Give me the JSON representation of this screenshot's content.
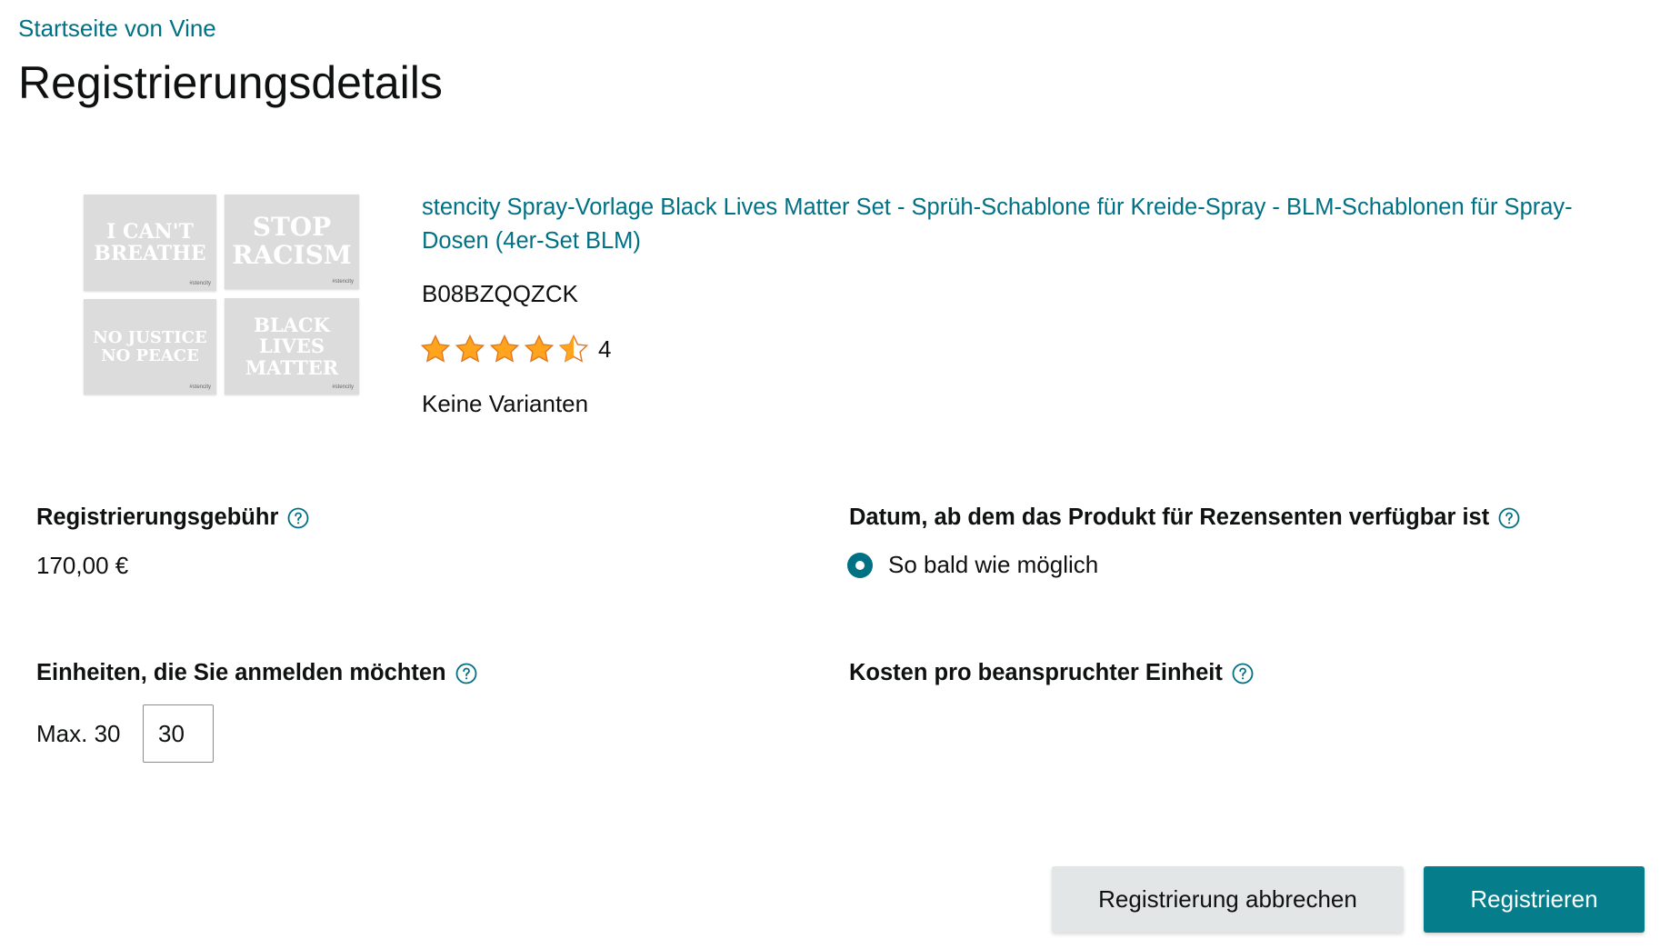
{
  "breadcrumb": {
    "label": "Startseite von Vine"
  },
  "page": {
    "title": "Registrierungsdetails"
  },
  "product": {
    "image": {
      "stencils": [
        {
          "text_lines": [
            "I CAN'T",
            "BREATHE"
          ],
          "mark": "#stencity"
        },
        {
          "text_lines": [
            "STOP",
            "RACISM"
          ],
          "mark": "#stencity"
        },
        {
          "text_lines": [
            "NO JUSTICE",
            "NO PEACE"
          ],
          "mark": "#stencity"
        },
        {
          "text_lines": [
            "BLACK",
            "LIVES",
            "MATTER"
          ],
          "mark": "#stencity"
        }
      ]
    },
    "title": "stencity Spray-Vorlage Black Lives Matter Set - Sprüh-Schablone für Kreide-Spray - BLM-Schablonen für Spray-Dosen (4er-Set BLM)",
    "asin": "B08BZQQZCK",
    "rating": {
      "stars": 4.5,
      "max": 5,
      "count": "4"
    },
    "variants": "Keine Varianten"
  },
  "fee": {
    "label": "Registrierungsgebühr",
    "value": "170,00 €"
  },
  "availability": {
    "label": "Datum, ab dem das Produkt für Rezensenten verfügbar ist",
    "option": "So bald wie möglich",
    "selected": true
  },
  "units": {
    "label": "Einheiten, die Sie anmelden möchten",
    "max_label": "Max. 30",
    "value": "30"
  },
  "cost": {
    "label": "Kosten pro beanspruchter Einheit"
  },
  "actions": {
    "cancel_label": "Registrierung abbrechen",
    "register_label": "Registrieren"
  },
  "colors": {
    "link": "#007185",
    "primary_button": "#067d8a",
    "secondary_button": "#e3e6e6",
    "star": "#ffa41c"
  }
}
